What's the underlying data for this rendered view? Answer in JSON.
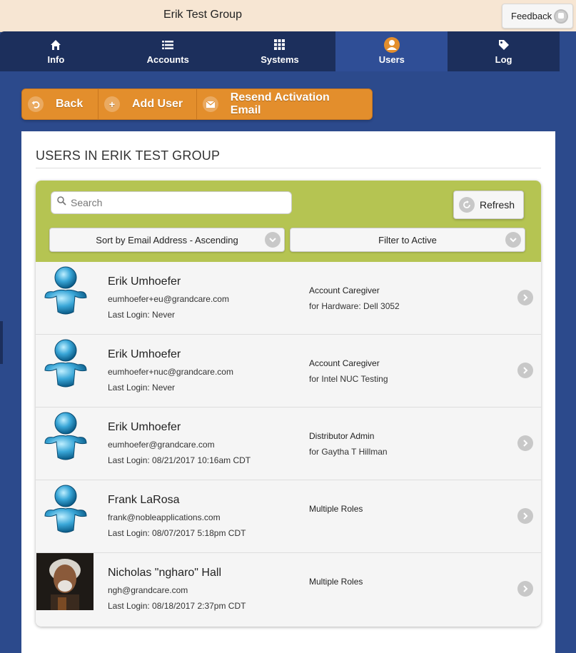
{
  "header": {
    "title": "Erik Test Group",
    "feedback_label": "Feedback"
  },
  "nav": {
    "tabs": [
      {
        "label": "Info",
        "icon": "home-icon"
      },
      {
        "label": "Accounts",
        "icon": "list-icon"
      },
      {
        "label": "Systems",
        "icon": "grid-icon"
      },
      {
        "label": "Users",
        "icon": "user-icon",
        "active": true
      },
      {
        "label": "Log",
        "icon": "tag-icon"
      }
    ]
  },
  "actions": {
    "back_label": "Back",
    "add_user_label": "Add User",
    "resend_label": "Resend Activation Email"
  },
  "panel": {
    "title": "USERS IN ERIK TEST GROUP",
    "search_placeholder": "Search",
    "refresh_label": "Refresh",
    "sort_label": "Sort by Email Address - Ascending",
    "filter_label": "Filter to Active"
  },
  "users": [
    {
      "name": "Erik Umhoefer",
      "email": "eumhoefer+eu@grandcare.com",
      "last_login": "Last Login: Never",
      "role": "Account Caregiver",
      "role_detail": "for Hardware: Dell 3052",
      "avatar": "default-avatar"
    },
    {
      "name": "Erik Umhoefer",
      "email": "eumhoefer+nuc@grandcare.com",
      "last_login": "Last Login: Never",
      "role": "Account Caregiver",
      "role_detail": "for Intel NUC Testing",
      "avatar": "default-avatar"
    },
    {
      "name": "Erik Umhoefer",
      "email": "eumhoefer@grandcare.com",
      "last_login": "Last Login: 08/21/2017 10:16am CDT",
      "role": "Distributor Admin",
      "role_detail": "for Gaytha T Hillman",
      "avatar": "default-avatar"
    },
    {
      "name": "Frank LaRosa",
      "email": "frank@nobleapplications.com",
      "last_login": "Last Login: 08/07/2017 5:18pm CDT",
      "role": "Multiple Roles",
      "role_detail": "",
      "avatar": "default-avatar"
    },
    {
      "name": "Nicholas \"ngharo\" Hall",
      "email": "ngh@grandcare.com",
      "last_login": "Last Login: 08/18/2017 2:37pm CDT",
      "role": "Multiple Roles",
      "role_detail": "",
      "avatar": "photo-avatar"
    }
  ],
  "colors": {
    "header_bg": "#f7e6d3",
    "nav_bg": "#1c2f5c",
    "nav_active": "#2f4e96",
    "page_bg": "#2c4a8c",
    "action_orange": "#e38e2c",
    "filter_green": "#b5c452"
  }
}
